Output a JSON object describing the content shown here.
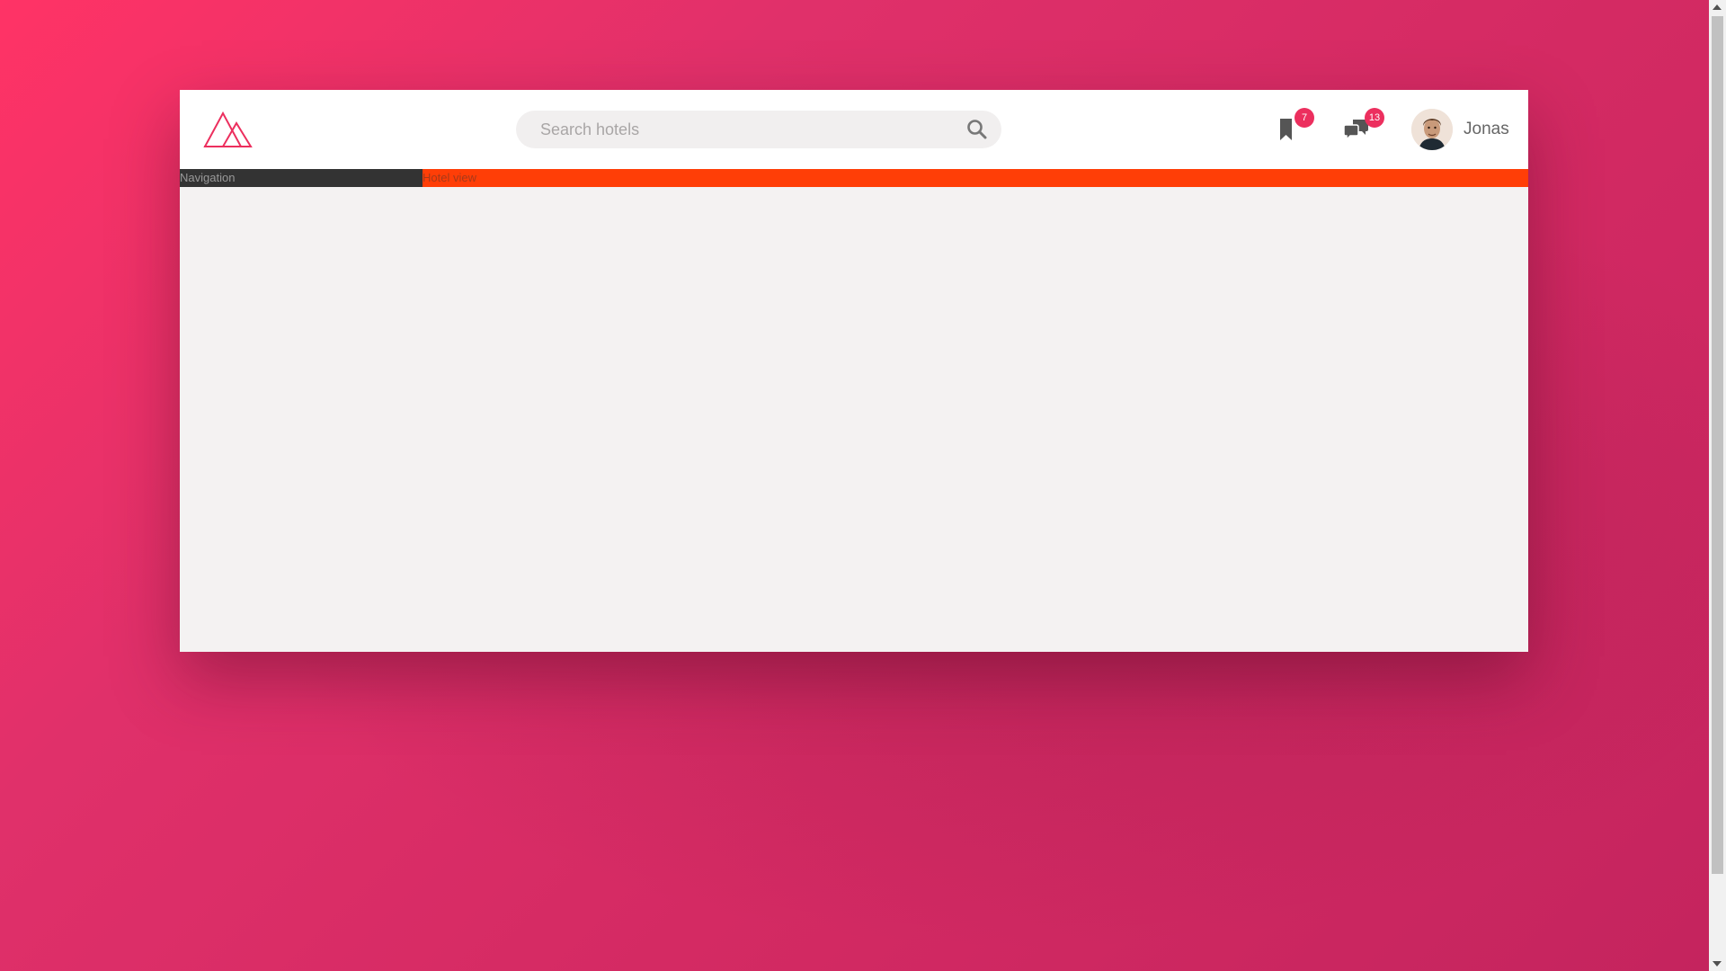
{
  "header": {
    "logo_icon": "triangles-logo-icon",
    "search": {
      "placeholder": "Search hotels",
      "icon": "search-icon"
    },
    "bookmarks": {
      "icon": "bookmark-icon",
      "count": "7"
    },
    "messages": {
      "icon": "chat-icon",
      "count": "13"
    },
    "user": {
      "name": "Jonas",
      "avatar_icon": "user-avatar"
    }
  },
  "layout": {
    "sidebar_label": "Navigation",
    "main_label": "Hotel view"
  },
  "colors": {
    "brand": "#ff3366",
    "badge": "#ec2f5e",
    "sidebar": "#333333",
    "hotel_view": "#ff3e07"
  }
}
